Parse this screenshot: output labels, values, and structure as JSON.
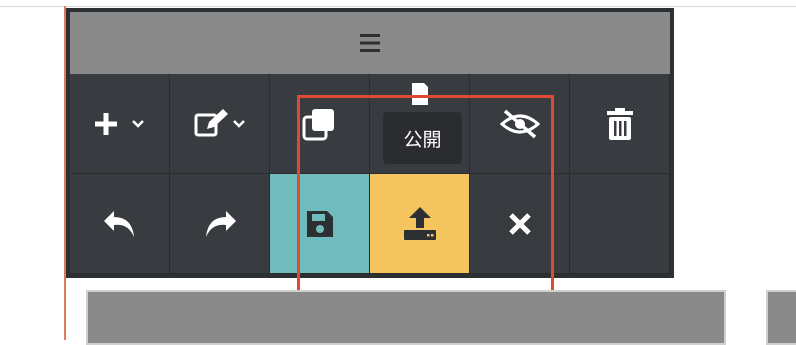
{
  "toolbar": {
    "handle_icon": "hamburger-menu-icon",
    "row1": [
      {
        "name": "add-dropdown-button",
        "icon": "plus-icon"
      },
      {
        "name": "edit-dropdown-button",
        "icon": "edit-icon"
      },
      {
        "name": "duplicate-button",
        "icon": "copy-icon"
      },
      {
        "name": "document-button",
        "icon": "document-icon"
      },
      {
        "name": "hide-button",
        "icon": "eye-slash-icon"
      },
      {
        "name": "delete-button",
        "icon": "trash-icon"
      }
    ],
    "row2": [
      {
        "name": "undo-button",
        "icon": "undo-icon"
      },
      {
        "name": "redo-button",
        "icon": "redo-icon"
      },
      {
        "name": "save-button",
        "icon": "save-icon",
        "color": "#70bcbc"
      },
      {
        "name": "publish-button",
        "icon": "upload-icon",
        "color": "#f4c45f"
      },
      {
        "name": "close-button",
        "icon": "close-icon"
      },
      {
        "name": "empty-cell",
        "icon": ""
      }
    ]
  },
  "tooltip": {
    "text": "公開"
  },
  "colors": {
    "toolbar_bg": "#383b3f",
    "handle_bg": "#8a8a8a",
    "save": "#70bcbc",
    "publish": "#f4c45f",
    "highlight": "#e04a32"
  }
}
